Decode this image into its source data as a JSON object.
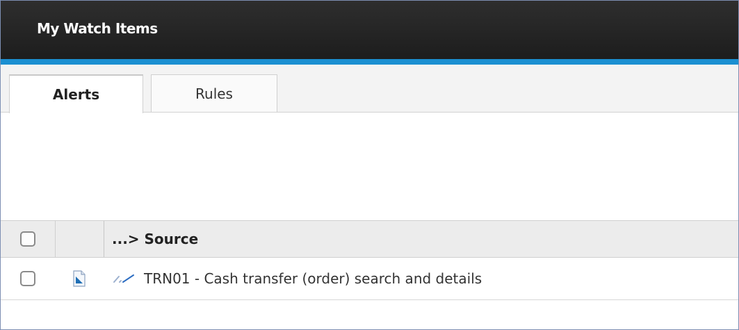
{
  "window": {
    "title": "My Watch Items"
  },
  "tabs": [
    {
      "label": "Alerts",
      "active": true
    },
    {
      "label": "Rules",
      "active": false
    }
  ],
  "table": {
    "columns": {
      "source": "...> Source"
    },
    "rows": [
      {
        "checked": false,
        "icon": "document-icon",
        "link_icon": "link-icon",
        "text": "TRN01 - Cash transfer (order) search and details"
      }
    ]
  },
  "colors": {
    "title_bar": "#1f1f1f",
    "accent": "#1b8fd1"
  }
}
